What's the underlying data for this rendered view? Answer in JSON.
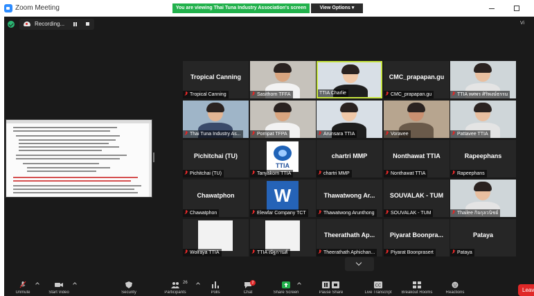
{
  "window": {
    "title": "Zoom Meeting",
    "share_banner": "You are viewing Thai Tuna Industry Association's screen",
    "view_options": "View Options",
    "view_label": "Vi"
  },
  "recording": {
    "label": "Recording..."
  },
  "colors": {
    "share_green": "#22b14c",
    "active_speaker": "#c8e640",
    "muted_red": "#e02828",
    "leave_red": "#e02828"
  },
  "participants": [
    {
      "big": "Tropical Canning",
      "label": "Tropical Canning",
      "muted": true,
      "video": "none"
    },
    {
      "big": "",
      "label": "Sasithorn TFFA",
      "muted": true,
      "video": "person"
    },
    {
      "big": "",
      "label": "TTIA Charlie",
      "muted": false,
      "video": "person",
      "active": true
    },
    {
      "big": "CMC_prapapan.gu",
      "label": "CMC_prapapan.gu",
      "muted": true,
      "video": "none"
    },
    {
      "big": "",
      "label": "TTIA ทศพร ศิริพงษ์ธรรม",
      "muted": true,
      "video": "person"
    },
    {
      "big": "",
      "label": "Thai Tuna Industry As...",
      "muted": true,
      "video": "person"
    },
    {
      "big": "",
      "label": "Pornpat TFPA",
      "muted": true,
      "video": "person"
    },
    {
      "big": "",
      "label": "Arunsara TTIA",
      "muted": true,
      "video": "person"
    },
    {
      "big": "",
      "label": "Voravee",
      "muted": true,
      "video": "person"
    },
    {
      "big": "",
      "label": "Pattavee TTIA",
      "muted": true,
      "video": "person"
    },
    {
      "big": "Pichitchai (TU)",
      "label": "Pichitchai (TU)",
      "muted": true,
      "video": "none"
    },
    {
      "big": "",
      "label": "Tanyakorn TTIA",
      "muted": true,
      "video": "ttia-logo",
      "logo_text": "TTIA"
    },
    {
      "big": "chartri MMP",
      "label": "chartri MMP",
      "muted": true,
      "video": "none"
    },
    {
      "big": "Nonthawat TTIA",
      "label": "Nonthawat TTIA",
      "muted": true,
      "video": "none"
    },
    {
      "big": "Rapeephans",
      "label": "Rapeephans",
      "muted": true,
      "video": "none"
    },
    {
      "big": "Chawatphon",
      "label": "Chawatphon",
      "muted": true,
      "video": "none"
    },
    {
      "big": "",
      "label": "Elewfar Company TCT",
      "muted": true,
      "video": "w-logo",
      "logo_text": "W"
    },
    {
      "big": "Thawatwong Ar...",
      "label": "Thawatwong Arunthong",
      "muted": true,
      "video": "none"
    },
    {
      "big": "SOUVALAK - TUM",
      "label": "SOUVALAK - TUM",
      "muted": true,
      "video": "none"
    },
    {
      "big": "",
      "label": "Thailee กิจกุลวนิชย์",
      "muted": true,
      "video": "person"
    },
    {
      "big": "",
      "label": "Wolraya TTIA",
      "muted": true,
      "video": "white"
    },
    {
      "big": "",
      "label": "TTIA ณัฐกานต์",
      "muted": true,
      "video": "white"
    },
    {
      "big": "Theerathath Ap...",
      "label": "Theerathath Aphichan...",
      "muted": true,
      "video": "none"
    },
    {
      "big": "Piyarat Boonpra...",
      "label": "Piyarat Boonprasert",
      "muted": true,
      "video": "none"
    },
    {
      "big": "Pataya",
      "label": "Pataya",
      "muted": true,
      "video": "none"
    }
  ],
  "toolbar": {
    "unmute": "Unmute",
    "start_video": "Start Video",
    "security": "Security",
    "participants": "Participants",
    "participants_count": "26",
    "polls": "Polls",
    "chat": "Chat",
    "chat_badge": "2",
    "share_screen": "Share Screen",
    "pause_share": "Pause Share",
    "live_transcript": "Live Transcript",
    "breakout_rooms": "Breakout Rooms",
    "reactions": "Reactions",
    "leave": "Leave"
  }
}
